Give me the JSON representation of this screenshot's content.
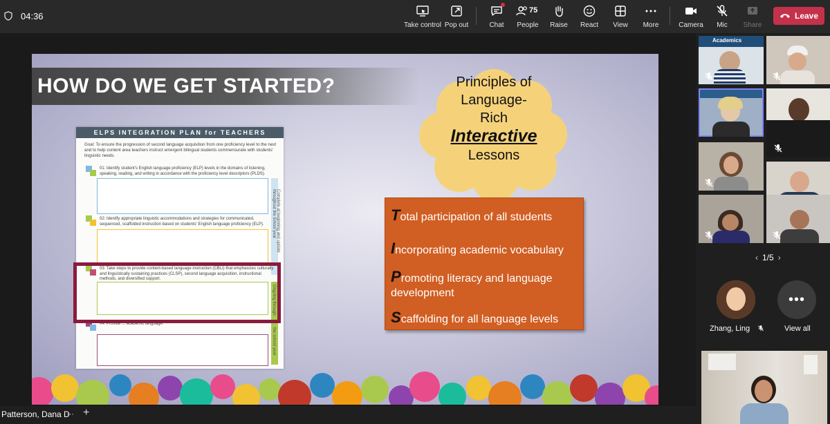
{
  "topbar": {
    "timer": "04:36",
    "controls": {
      "take_control": "Take control",
      "pop_out": "Pop out",
      "chat": "Chat",
      "people": "People",
      "people_count": "75",
      "raise": "Raise",
      "react": "React",
      "view": "View",
      "more": "More",
      "camera": "Camera",
      "mic": "Mic",
      "share": "Share"
    },
    "leave": "Leave",
    "colors": {
      "leave": "#c4314b",
      "bar": "#292929"
    }
  },
  "slide": {
    "title": "HOW DO WE GET STARTED?",
    "cloud": {
      "line1": "Principles of",
      "line2": "Language-",
      "line3": "Rich",
      "line4": "Interactive",
      "line5": "Lessons"
    },
    "tips": [
      {
        "cap": "T",
        "rest": "otal participation of all students"
      },
      {
        "cap": "I",
        "rest": "ncorporating academic vocabulary"
      },
      {
        "cap": "P",
        "rest": "romoting literacy and language development"
      },
      {
        "cap": "S",
        "rest": "caffolding for all language levels"
      }
    ],
    "document": {
      "heading": "ELPS INTEGRATION PLAN for TEACHERS",
      "goal": "Goal: To ensure the progression of second language acquisition from one proficiency level to the next and to help content area teachers instruct emergent bilingual students commensurate with students' linguistic needs.",
      "step1": "01: Identify student's English language proficiency (ELP) levels in the domains of listening, speaking, reading, and writing in accordance with the proficiency level descriptors (PLDS).",
      "step2": "02: Identify appropriate linguistic accommodations and strategies for communicated, sequenced, scaffolded instruction based on students' English language proficiency (ELP).",
      "step3": "03: Take steps to provide content-based language instruction (CBLI) that emphasizes culturally and linguistically sustaining practices (CLSP), second language acquisition, instructional methods, and diversified support.",
      "step4": "04: Provide ... academic language.",
      "side1": "Complete at beginning and update throughout the school year",
      "side2": "Ongoing through",
      "side3": "the school year"
    }
  },
  "bottombar": {
    "presenter": "Patterson, Dana D"
  },
  "panel": {
    "banner": "Academics",
    "pager": "1/5",
    "participant": "Zhang, Ling",
    "view_all": "View all"
  }
}
